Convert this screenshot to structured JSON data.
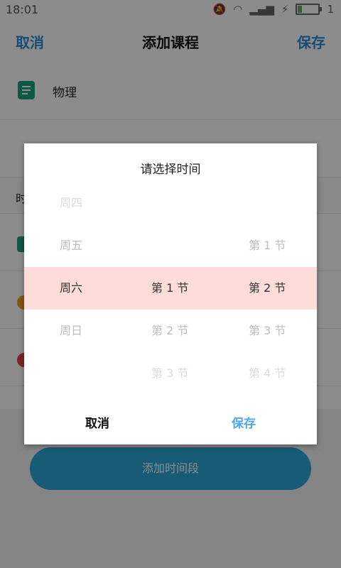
{
  "status_bar": {
    "time": "18:01",
    "battery_level": "1"
  },
  "app_bar": {
    "cancel_label": "取消",
    "title": "添加课程",
    "save_label": "保存"
  },
  "form": {
    "course_name": "物理",
    "time_section_label": "时"
  },
  "add_time_button": "添加时间段",
  "dialog": {
    "title": "请选择时间",
    "cancel_label": "取消",
    "save_label": "保存",
    "highlight_color": "#fddcda",
    "columns": {
      "weekday": [
        "周四",
        "周五",
        "周六",
        "周日",
        ""
      ],
      "start": [
        "",
        "",
        "第 1 节",
        "第 2 节",
        "第 3 节"
      ],
      "end": [
        "",
        "第 1 节",
        "第 2 节",
        "第 3 节",
        "第 4 节"
      ]
    },
    "selected": {
      "weekday": "周六",
      "start": "第 1 节",
      "end": "第 2 节"
    }
  },
  "accent_color": "#2a8dd6"
}
